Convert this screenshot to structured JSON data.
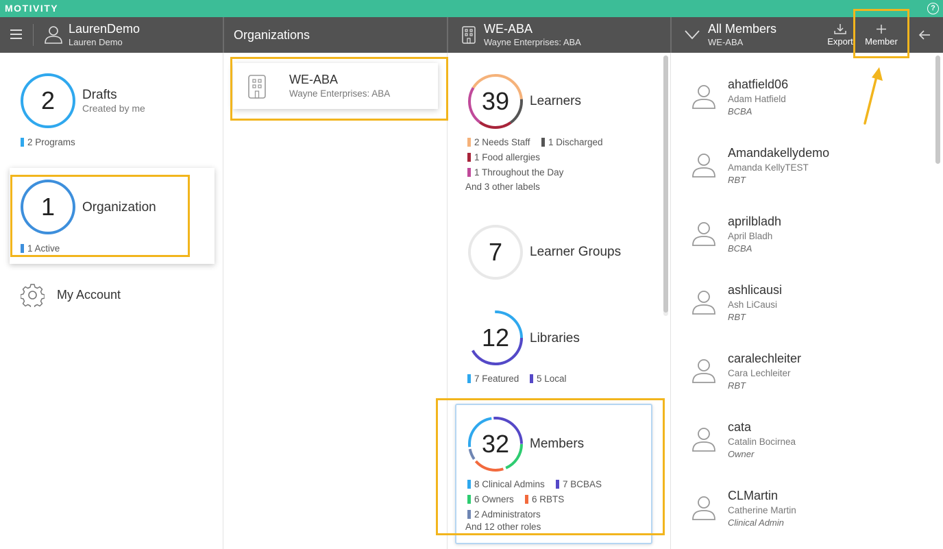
{
  "brand": {
    "name": "MOTIVITY",
    "help_glyph": "?"
  },
  "header": {
    "user": {
      "title": "LaurenDemo",
      "subtitle": "Lauren Demo"
    },
    "organizations": {
      "title": "Organizations"
    },
    "org": {
      "title": "WE-ABA",
      "subtitle": "Wayne Enterprises: ABA"
    },
    "members": {
      "title": "All Members",
      "subtitle": "WE-ABA",
      "export_label": "Export",
      "add_label": "Member"
    }
  },
  "colors": {
    "brand": "#3cbd97",
    "header_bg": "#525252",
    "highlight": "#f2b51d",
    "ring_blue": "#2fa8ee",
    "ring_org": "#3d8fdc"
  },
  "nav": {
    "drafts": {
      "count": "2",
      "title": "Drafts",
      "subtitle": "Created by me",
      "tag": "2 Programs"
    },
    "organization": {
      "count": "1",
      "title": "Organization",
      "tag": "1 Active"
    },
    "account": {
      "label": "My Account"
    }
  },
  "organizations": [
    {
      "code": "WE-ABA",
      "name": "Wayne Enterprises: ABA"
    }
  ],
  "summary": {
    "learners": {
      "count": "39",
      "title": "Learners",
      "tags": [
        "2 Needs Staff",
        "1 Discharged",
        "1 Food allergies",
        "1 Throughout the Day"
      ],
      "tag_colors": [
        "#f5b27a",
        "#555555",
        "#a8243a",
        "#c04a9a"
      ],
      "more": "And 3 other labels"
    },
    "groups": {
      "count": "7",
      "title": "Learner Groups"
    },
    "libraries": {
      "count": "12",
      "title": "Libraries",
      "tags": [
        "7 Featured",
        "5 Local"
      ],
      "tag_colors": [
        "#2fa8ee",
        "#5548c7"
      ]
    },
    "members": {
      "count": "32",
      "title": "Members",
      "tags": [
        "8 Clinical Admins",
        "7 BCBAS",
        "6 Owners",
        "6 RBTS",
        "2 Administrators"
      ],
      "tag_colors": [
        "#2fa8ee",
        "#5548c7",
        "#2ecc71",
        "#f26a3d",
        "#6f86b3"
      ],
      "more": "And 12 other roles"
    }
  },
  "members_list": [
    {
      "username": "ahatfield06",
      "name": "Adam Hatfield",
      "role": "BCBA"
    },
    {
      "username": "Amandakellydemo",
      "name": "Amanda KellyTEST",
      "role": "RBT"
    },
    {
      "username": "aprilbladh",
      "name": "April Bladh",
      "role": "BCBA"
    },
    {
      "username": "ashlicausi",
      "name": "Ash LiCausi",
      "role": "RBT"
    },
    {
      "username": "caralechleiter",
      "name": "Cara Lechleiter",
      "role": "RBT"
    },
    {
      "username": "cata",
      "name": "Catalin Bocirnea",
      "role": "Owner"
    },
    {
      "username": "CLMartin",
      "name": "Catherine Martin",
      "role": "Clinical Admin"
    }
  ]
}
